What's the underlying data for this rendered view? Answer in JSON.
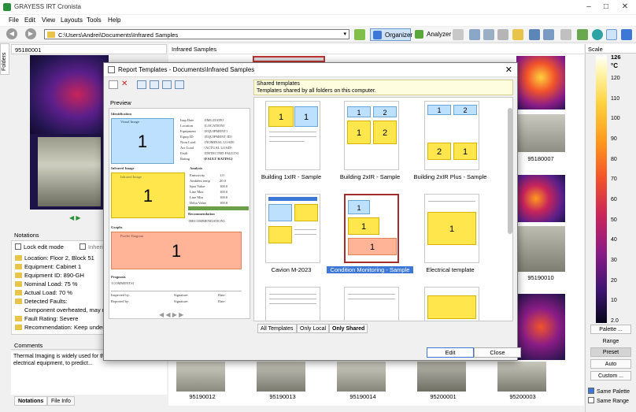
{
  "window": {
    "title": "GRAYESS IRT Cronista"
  },
  "menu": [
    "File",
    "Edit",
    "View",
    "Layouts",
    "Tools",
    "Help"
  ],
  "toolbar": {
    "path": "C:\\Users\\Andrei\\Documents\\Infrared Samples",
    "organizer": "Organizer",
    "analyzer": "Analyzer"
  },
  "sidebar": {
    "folders_tab": "Folders"
  },
  "left": {
    "header": "95180001",
    "notations_title": "Notations",
    "lock_edit": "Lock edit mode",
    "inherit": "Inherit notat",
    "notations": [
      "Location: Floor 2, Block 51",
      "Equipment: Cabinet 1",
      "Equipment ID: 890-GH",
      "Nominal Load: 75 %",
      "Actual Load: 70 %",
      "Detected Faults:",
      "Component overheated, may ne",
      "Fault Rating: Severe",
      "Recommendation: Keep under o"
    ],
    "comments_title": "Comments",
    "comments_text": "Thermal Imaging is widely used for th of machinery and electrical equipment, to predict...",
    "tabs": [
      "Notations",
      "File Info"
    ]
  },
  "center": {
    "header": "Infrared Samples",
    "labels": [
      "95180007",
      "95190010",
      "95190012",
      "95190013",
      "95190014",
      "95200001",
      "95200003"
    ]
  },
  "scale": {
    "title": "Scale",
    "max": "126",
    "unit": "°C",
    "ticks": [
      "120",
      "110",
      "100",
      "90",
      "80",
      "70",
      "60",
      "50",
      "40",
      "30",
      "20",
      "10",
      "2.0"
    ],
    "buttons": [
      "Palette ...",
      "Range",
      "Preset",
      "Auto",
      "Custom ..."
    ],
    "same_palette": "Same Palette",
    "same_range": "Same Range"
  },
  "dialog": {
    "title": "Report Templates - Documents\\Infrared Samples",
    "preview_label": "Preview",
    "shared_title": "Shared templates",
    "shared_desc": "Templates shared by all folders on this computer.",
    "templates": [
      "Building 1xIR - Sample",
      "Building 2xIR - Sample",
      "Building 2xIR Plus - Sample",
      "Cavion M-2023",
      "Condition Monitoring - Sample",
      "Electrical template"
    ],
    "tabs": [
      "All Templates",
      "Only Local",
      "Only Shared"
    ],
    "edit": "Edit",
    "close": "Close",
    "preview": {
      "identification": "Identification",
      "visual_image": "Visual Image",
      "infrared_image": "Infrared Image",
      "profile_diagram": "Profile Diagram",
      "analysis": "Analysis",
      "recommendation": "Recommendation",
      "graphs": "Graphs",
      "prognosis": "Prognosis",
      "fields": [
        "Insp Date",
        "Location",
        "Equipment",
        "Equip ID",
        "Nom Load",
        "Act Load",
        "Fault",
        "Rating"
      ],
      "values": [
        "{IMG DATE}",
        "{LOCATION}",
        "{EQUIPMENT}",
        "{EQUIPMENT ID}",
        "{NOMINAL LOAD}",
        "{ACTUAL LOAD}",
        "{DETECTED FAULTS}",
        "{FAULT RATING}"
      ],
      "analysis_fields": [
        "Emissivity",
        "Ambient temp",
        "Spot Value",
        "Line Max",
        "Line Min",
        "Delta Value"
      ],
      "analysis_values": [
        "1.0",
        "20.0",
        "100.0",
        "100.0",
        "100.0",
        "100.0"
      ],
      "recommendation_value": "{RECOMMENDATION}",
      "prognosis_value": "{COMMENTS}",
      "footer": [
        "Inspected by:",
        "Signature:",
        "Date:",
        "Reported by:",
        "Signature:",
        "Date:"
      ]
    }
  }
}
